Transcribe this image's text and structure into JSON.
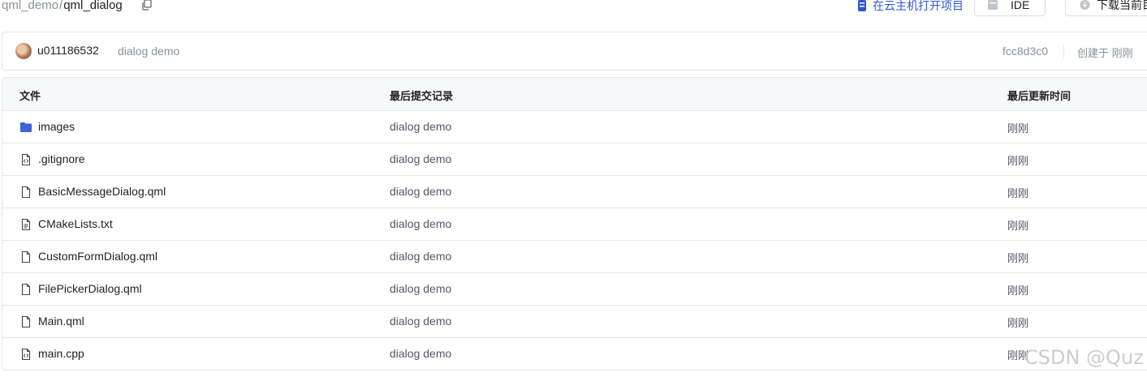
{
  "breadcrumb": {
    "owner": "qml_demo",
    "separator": "/",
    "repo": "qml_dialog"
  },
  "actions": {
    "cloud_open_label": "在云主机打开项目",
    "ide_label": "IDE",
    "download_label": "下载当前目"
  },
  "commit": {
    "author": "u011186532",
    "message": "dialog demo",
    "hash": "fcc8d3c0",
    "created": "创建于 刚刚"
  },
  "table": {
    "headers": {
      "file": "文件",
      "commit": "最后提交记录",
      "time": "最后更新时间"
    },
    "rows": [
      {
        "name": "images",
        "icon": "folder-icon",
        "commit": "dialog demo",
        "time": "刚刚"
      },
      {
        "name": ".gitignore",
        "icon": "code-file-icon",
        "commit": "dialog demo",
        "time": "刚刚"
      },
      {
        "name": "BasicMessageDialog.qml",
        "icon": "file-icon",
        "commit": "dialog demo",
        "time": "刚刚"
      },
      {
        "name": "CMakeLists.txt",
        "icon": "text-file-icon",
        "commit": "dialog demo",
        "time": "刚刚"
      },
      {
        "name": "CustomFormDialog.qml",
        "icon": "file-icon",
        "commit": "dialog demo",
        "time": "刚刚"
      },
      {
        "name": "FilePickerDialog.qml",
        "icon": "file-icon",
        "commit": "dialog demo",
        "time": "刚刚"
      },
      {
        "name": "Main.qml",
        "icon": "file-icon",
        "commit": "dialog demo",
        "time": "刚刚"
      },
      {
        "name": "main.cpp",
        "icon": "code-file-icon",
        "commit": "dialog demo",
        "time": "刚刚"
      }
    ]
  },
  "colors": {
    "accent": "#2f56d9",
    "folder": "#3e63dd",
    "muted": "#8a8f99",
    "border": "#e5e6eb"
  },
  "watermark": "CSDN @Quz"
}
